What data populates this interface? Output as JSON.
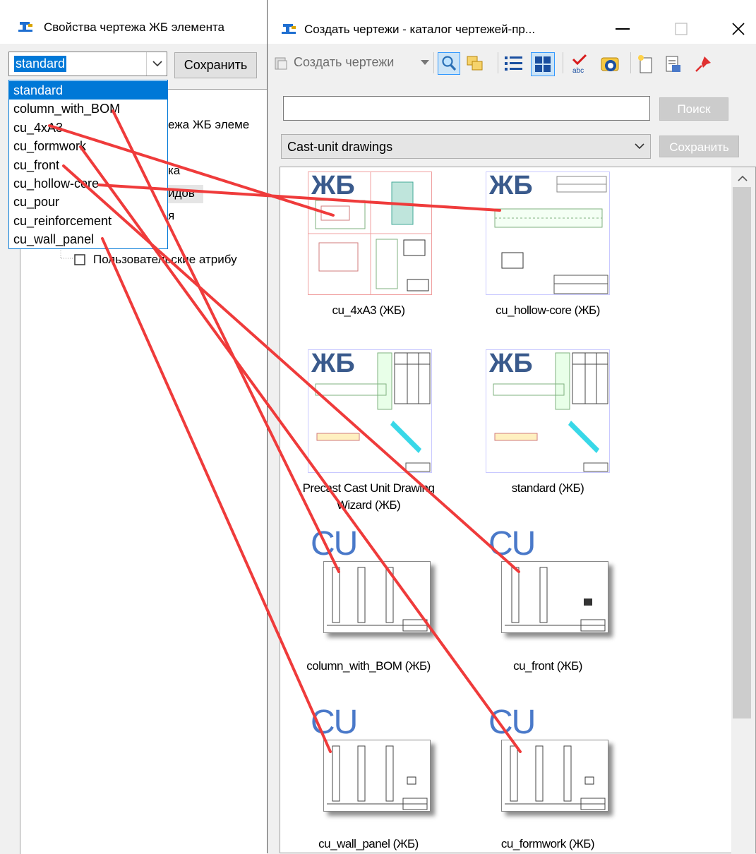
{
  "left_window": {
    "title": "Свойства чертежа ЖБ элемента",
    "combo_value": "standard",
    "save_label": "Сохранить",
    "tree": [
      "ежа ЖБ элеме",
      "ка",
      "идов",
      "я",
      "Пользовательские атрибу"
    ],
    "dropdown_items": [
      "standard",
      "column_with_BOM",
      "cu_4xA3",
      "cu_formwork",
      "cu_front",
      "cu_hollow-core",
      "cu_pour",
      "cu_reinforcement",
      "cu_wall_panel"
    ],
    "dropdown_selected": "standard"
  },
  "right_window": {
    "title": "Создать чертежи - каталог чертежей-пр...",
    "toolbar": {
      "create_label": "Создать чертежи",
      "icons": [
        "search-icon",
        "copy-icon",
        "list-view-icon",
        "thumbnail-view-icon",
        "spellcheck-icon",
        "refresh-icon",
        "new-icon",
        "properties-icon",
        "pin-icon"
      ]
    },
    "search": {
      "value": "",
      "button_label": "Поиск"
    },
    "category": {
      "value": "Cast-unit drawings",
      "save_label": "Сохранить"
    },
    "catalog_items": [
      {
        "badge": "ЖБ",
        "caption": "cu_4xA3 (ЖБ)"
      },
      {
        "badge": "ЖБ",
        "caption": "cu_hollow-core (ЖБ)"
      },
      {
        "badge": "ЖБ",
        "caption_line1": "Precast Cast Unit Drawing",
        "caption_line2": "Wizard (ЖБ)"
      },
      {
        "badge": "ЖБ",
        "caption": "standard (ЖБ)"
      },
      {
        "badge": "CU",
        "caption": "column_with_BOM (ЖБ)"
      },
      {
        "badge": "CU",
        "caption": "cu_front (ЖБ)"
      },
      {
        "badge": "CU",
        "caption": "cu_wall_panel (ЖБ)"
      },
      {
        "badge": "CU",
        "caption": "cu_formwork (ЖБ)"
      }
    ]
  },
  "colors": {
    "selection": "#0078d7",
    "annotation": "#ef3b3b"
  }
}
